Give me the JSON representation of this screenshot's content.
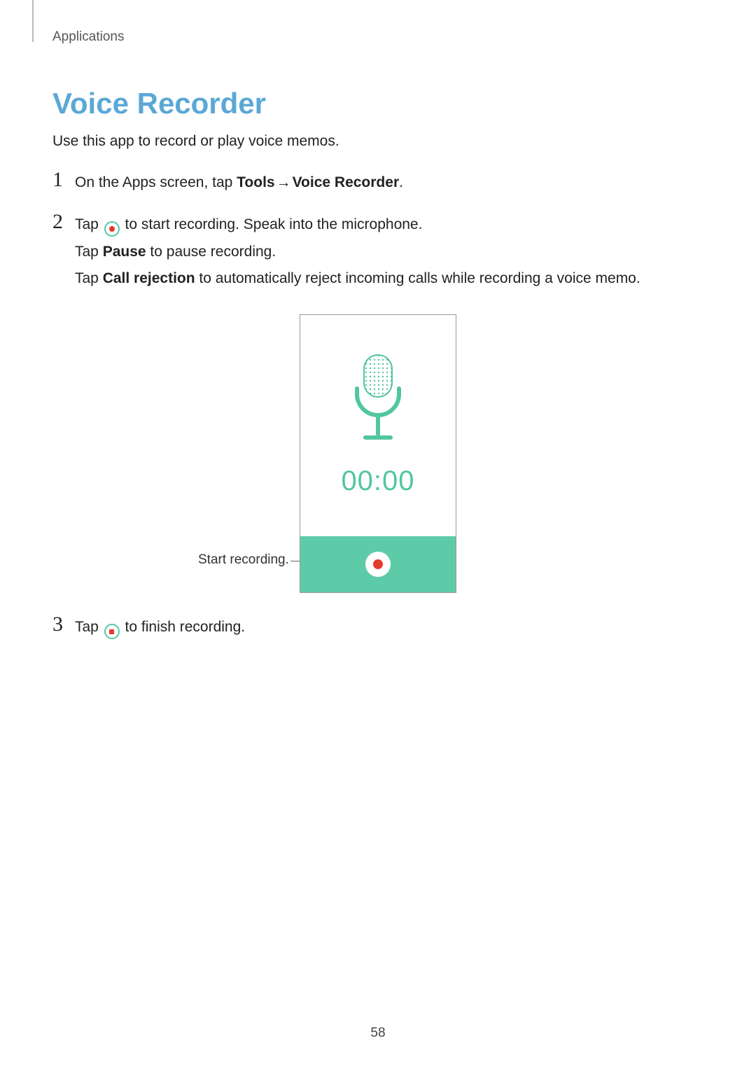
{
  "section_label": "Applications",
  "title": "Voice Recorder",
  "intro": "Use this app to record or play voice memos.",
  "steps": {
    "s1": {
      "num": "1",
      "prefix": "On the Apps screen, tap ",
      "bold1": "Tools",
      "arrow": "→",
      "bold2": "Voice Recorder",
      "suffix": "."
    },
    "s2": {
      "num": "2",
      "l1_prefix": "Tap ",
      "l1_suffix": " to start recording. Speak into the microphone.",
      "l2_prefix": "Tap ",
      "l2_bold": "Pause",
      "l2_suffix": " to pause recording.",
      "l3_prefix": "Tap ",
      "l3_bold": "Call rejection",
      "l3_suffix": " to automatically reject incoming calls while recording a voice memo."
    },
    "s3": {
      "num": "3",
      "prefix": "Tap ",
      "suffix": " to finish recording."
    }
  },
  "figure": {
    "callout": "Start recording.",
    "timer": "00:00"
  },
  "page_number": "58"
}
